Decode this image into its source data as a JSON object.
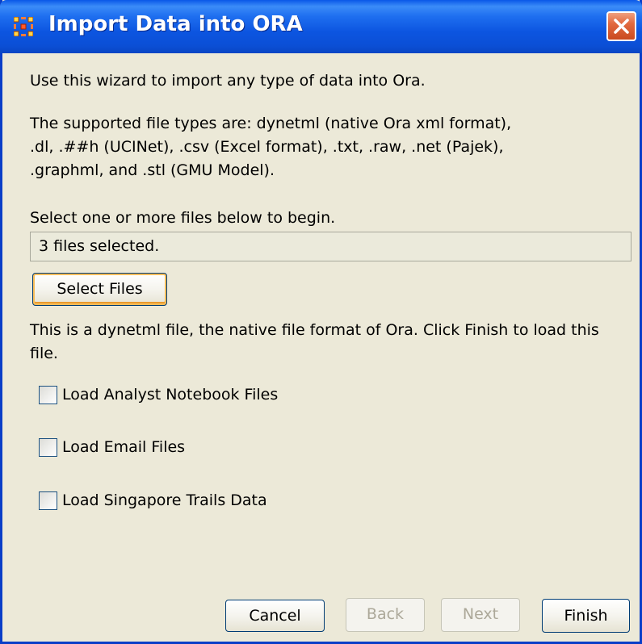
{
  "window": {
    "title": "Import Data into ORA",
    "app_icon": "ora-grid-icon",
    "close_icon": "close-icon"
  },
  "content": {
    "intro": "Use this wizard to import any type of data into Ora.",
    "supported_line1": "The supported file types are: dynetml (native Ora xml format),",
    "supported_line2": ".dl, .##h (UCINet), .csv (Excel format), .txt, .raw, .net (Pajek),",
    "supported_line3": ".graphml, and .stl (GMU Model).",
    "select_prompt": "Select one or more files below to begin.",
    "files_field_value": "3 files selected.",
    "select_files_label": "Select Files",
    "status_line1": "This is a dynetml file, the native file format of Ora. Click Finish to load this",
    "status_line2": "file."
  },
  "options": [
    {
      "label": "Load Analyst Notebook Files",
      "checked": false
    },
    {
      "label": "Load Email Files",
      "checked": false
    },
    {
      "label": "Load Singapore Trails Data",
      "checked": false
    }
  ],
  "footer": {
    "cancel_label": "Cancel",
    "back_label": "Back",
    "next_label": "Next",
    "finish_label": "Finish"
  },
  "colors": {
    "titlebar": "#0b4fd6",
    "window_bg": "#ece9d8",
    "close_button": "#e26a40",
    "focus_ring": "#f6bd5b"
  }
}
